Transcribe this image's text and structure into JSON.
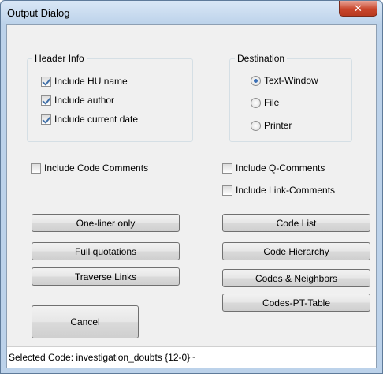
{
  "window": {
    "title": "Output Dialog",
    "close_icon": "close-icon"
  },
  "header_info": {
    "label": "Header Info",
    "options": [
      {
        "label": "Include HU name",
        "checked": true
      },
      {
        "label": "Include author",
        "checked": true
      },
      {
        "label": "Include current date",
        "checked": true
      }
    ]
  },
  "destination": {
    "label": "Destination",
    "options": [
      {
        "label": "Text-Window",
        "selected": true
      },
      {
        "label": "File",
        "selected": false
      },
      {
        "label": "Printer",
        "selected": false
      }
    ]
  },
  "comments": {
    "code_comments": {
      "label": "Include Code Comments",
      "checked": false
    },
    "q_comments": {
      "label": "Include Q-Comments",
      "checked": false
    },
    "link_comments": {
      "label": "Include Link-Comments",
      "checked": false
    }
  },
  "buttons": {
    "one_liner": "One-liner only",
    "full_quotations": "Full quotations",
    "traverse_links": "Traverse Links",
    "cancel": "Cancel",
    "code_list": "Code List",
    "code_hierarchy": "Code Hierarchy",
    "codes_neighbors": "Codes & Neighbors",
    "codes_pt_table": "Codes-PT-Table"
  },
  "status": {
    "text": "Selected Code: investigation_doubts {12-0}~"
  }
}
